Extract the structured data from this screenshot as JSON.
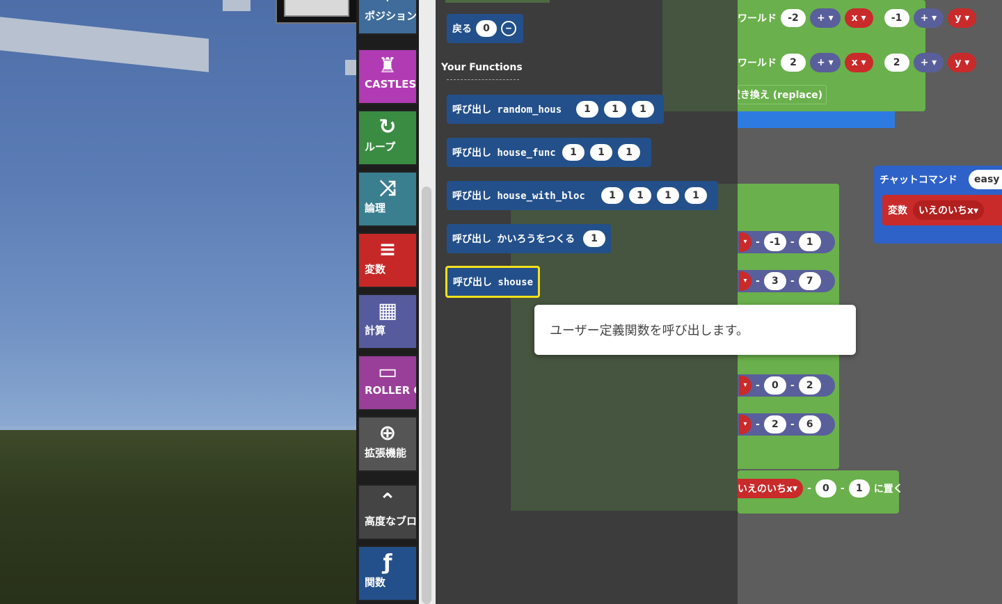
{
  "toolbar": {
    "categories": [
      {
        "label": "ポジション",
        "icon": "crosshair-icon",
        "color": "#3f6c9a"
      },
      {
        "label": "CASTLES",
        "icon": "castle-icon",
        "color": "#b13bb3"
      },
      {
        "label": "ループ",
        "icon": "loop-icon",
        "color": "#3b8c43"
      },
      {
        "label": "論理",
        "icon": "shuffle-icon",
        "color": "#3a7f8f"
      },
      {
        "label": "変数",
        "icon": "list-icon",
        "color": "#c62828"
      },
      {
        "label": "計算",
        "icon": "calculator-icon",
        "color": "#565b9e"
      },
      {
        "label": "ROLLER C",
        "icon": "ticket-icon",
        "color": "#9a3f99"
      },
      {
        "label": "拡張機能",
        "icon": "plus-circle-icon",
        "color": "#555555"
      },
      {
        "label": "高度なブロ",
        "icon": "chevron-up-icon",
        "color": "#444444"
      },
      {
        "label": "関数",
        "icon": "function-icon",
        "color": "#23508a"
      }
    ]
  },
  "flyout": {
    "return_block": {
      "label": "戻る",
      "value": "0"
    },
    "section_title": "Your Functions",
    "functions": [
      {
        "label": "呼び出し random_hous",
        "args": [
          "1",
          "1",
          "1"
        ]
      },
      {
        "label": "呼び出し house_func",
        "args": [
          "1",
          "1",
          "1"
        ]
      },
      {
        "label": "呼び出し house_with_bloc",
        "args": [
          "1",
          "1",
          "1",
          "1"
        ]
      },
      {
        "label": "呼び出し かいろうをつくる",
        "args": [
          "1"
        ]
      },
      {
        "label": "呼び出し shouse",
        "args": []
      }
    ]
  },
  "tooltip": {
    "text": "ユーザー定義関数を呼び出します。"
  },
  "workspace": {
    "world_label": "ワールド",
    "row1": {
      "a": "-2",
      "b": "-1",
      "opx": "+",
      "opy": "+",
      "x": "x",
      "y": "y"
    },
    "row2": {
      "a": "2",
      "b": "2",
      "opx": "+",
      "opy": "+",
      "x": "x",
      "y": "y"
    },
    "mode_label": "モード 置き換え (replace)",
    "chat_label": "チャットコマンド",
    "chat_value": "easy",
    "var_label": "変数",
    "var_name": "いえのいちx",
    "pos_rows": [
      {
        "a": "-1",
        "b": "1"
      },
      {
        "a": "3",
        "b": "7"
      },
      {
        "a": "0",
        "b": "2"
      },
      {
        "a": "2",
        "b": "6"
      }
    ],
    "bottom_row": {
      "var": "いえのいちx",
      "a": "0",
      "b": "1",
      "suffix": "に置く"
    }
  }
}
